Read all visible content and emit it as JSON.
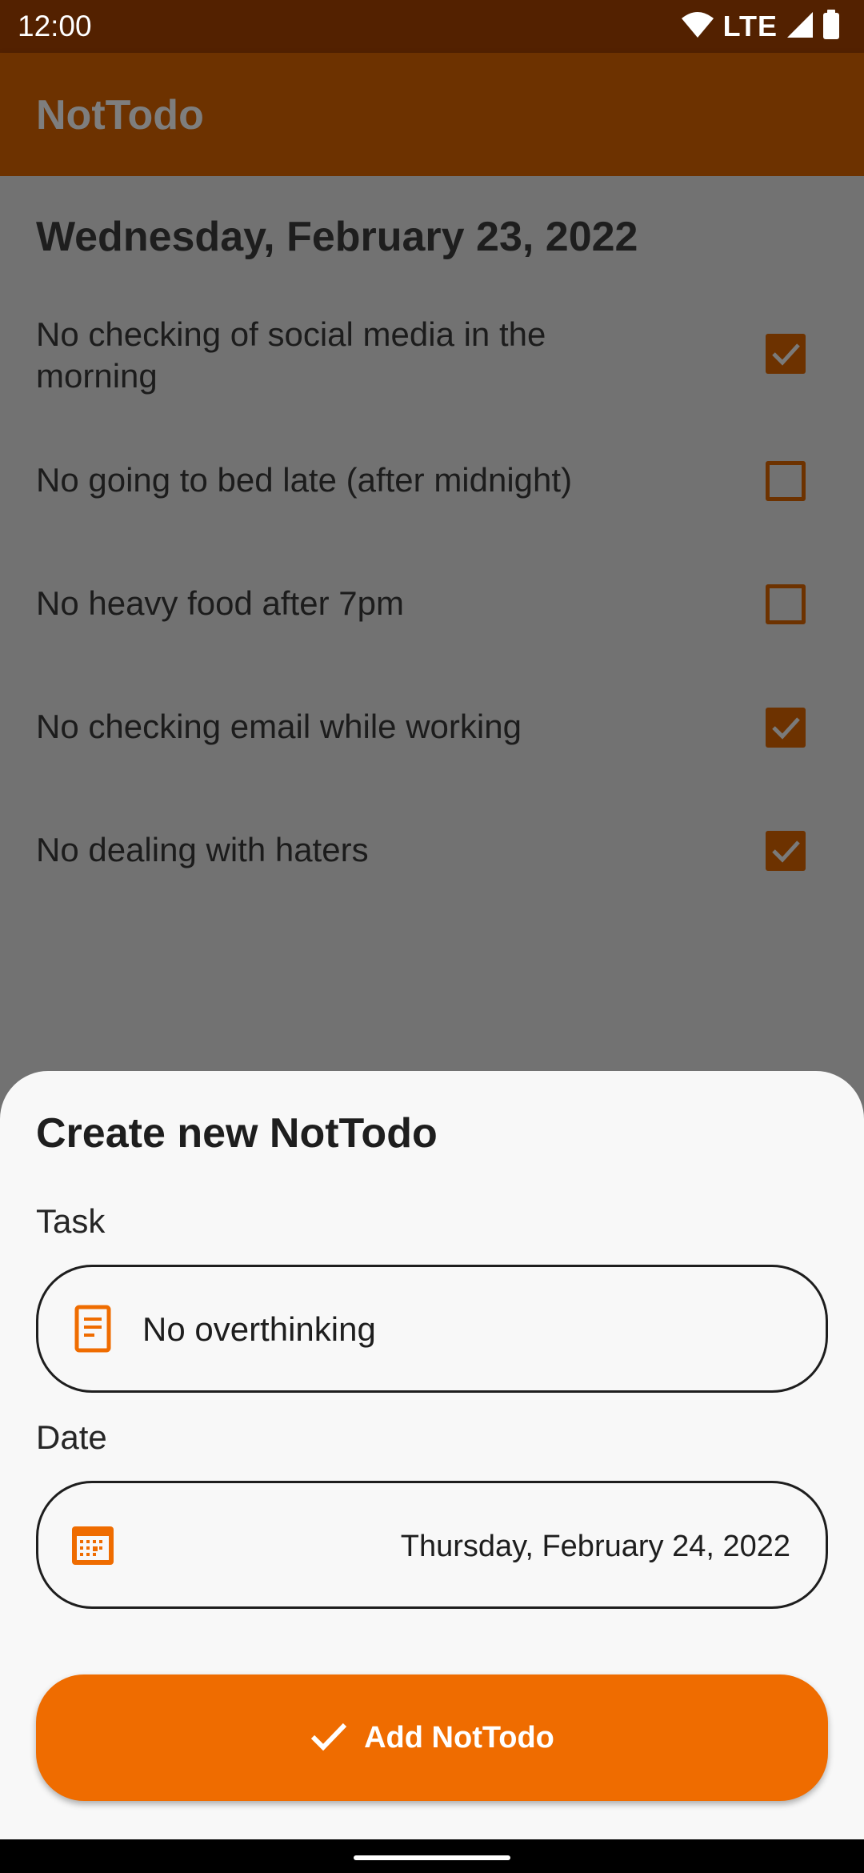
{
  "status_bar": {
    "time": "12:00",
    "network": "LTE",
    "icons": [
      "wifi-icon",
      "cellular-signal-icon",
      "battery-icon"
    ]
  },
  "app_bar": {
    "title": "NotTodo"
  },
  "list": {
    "date_heading": "Wednesday, February 23, 2022",
    "items": [
      {
        "text": "No checking of social media in the morning",
        "checked": true
      },
      {
        "text": "No going to bed late (after midnight)",
        "checked": false
      },
      {
        "text": "No heavy food after 7pm",
        "checked": false
      },
      {
        "text": "No checking email while working",
        "checked": true
      },
      {
        "text": "No dealing with haters",
        "checked": true
      }
    ]
  },
  "sheet": {
    "title": "Create new NotTodo",
    "task_label": "Task",
    "task_value": "No overthinking",
    "task_icon": "note-icon",
    "date_label": "Date",
    "date_value": "Thursday, February 24, 2022",
    "date_icon": "calendar-icon",
    "add_button_label": "Add NotTodo",
    "add_button_icon": "check-icon"
  },
  "colors": {
    "accent": "#ef6c00",
    "app_bar": "#6d3200",
    "status_bar": "#532100",
    "scrim_background": "#727272",
    "sheet_background": "#f8f8f8"
  }
}
